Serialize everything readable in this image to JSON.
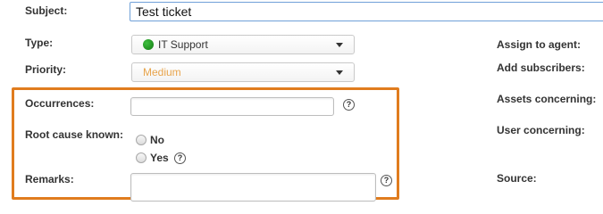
{
  "form": {
    "subject": {
      "label": "Subject:",
      "value": "Test ticket"
    },
    "type": {
      "label": "Type:",
      "value": "IT Support",
      "icon": "green-circle-icon",
      "icon_color": "#1a8f1a"
    },
    "priority": {
      "label": "Priority:",
      "value": "Medium",
      "value_color": "#e8a44c"
    },
    "occurrences": {
      "label": "Occurrences:",
      "value": ""
    },
    "root_cause": {
      "label": "Root cause known:",
      "options": [
        "No",
        "Yes"
      ],
      "selected": null
    },
    "remarks": {
      "label": "Remarks:",
      "value": ""
    }
  },
  "side_labels": {
    "assign": "Assign to agent:",
    "subscribers": "Add subscribers:",
    "assets": "Assets concerning:",
    "user": "User concerning:",
    "source": "Source:"
  },
  "help_glyph": "?",
  "highlight_color": "#e07c1e"
}
